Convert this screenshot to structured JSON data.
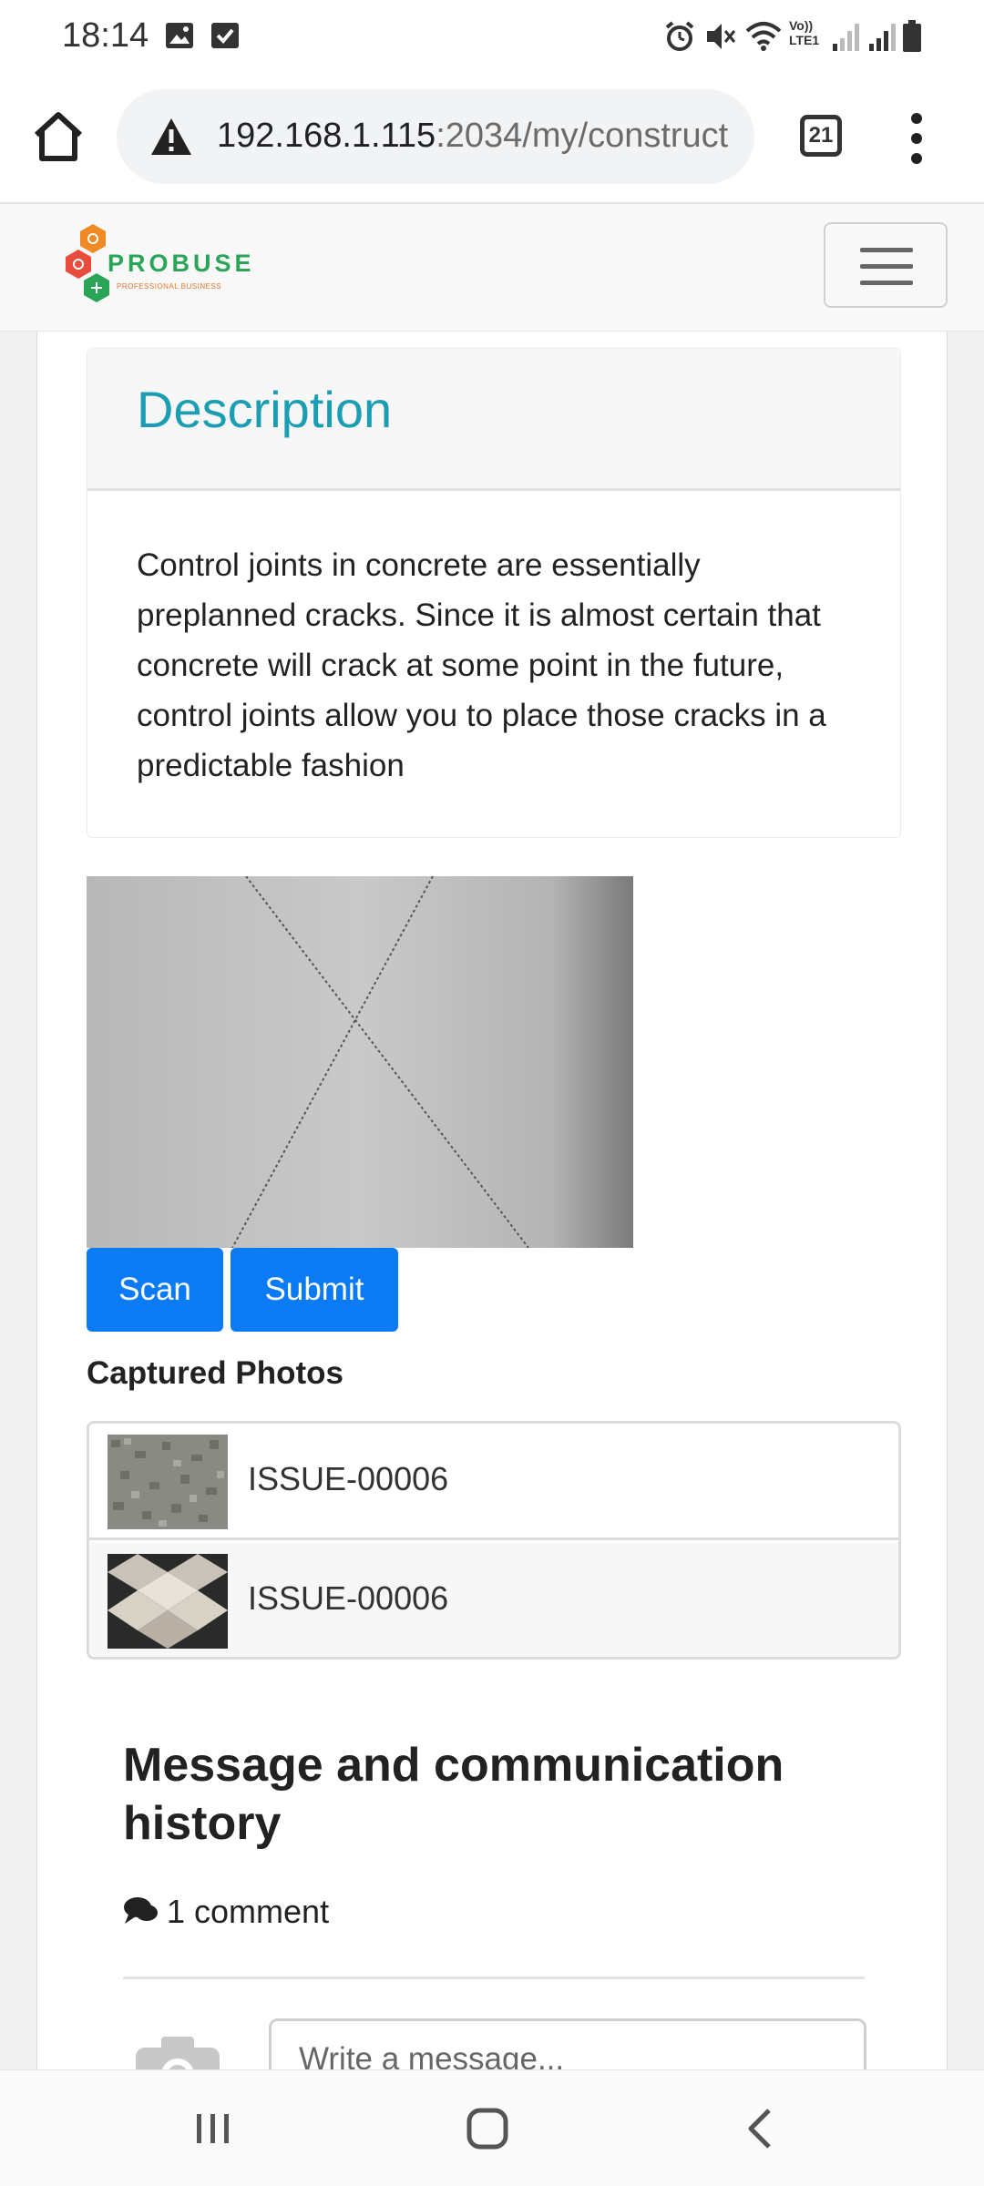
{
  "status_bar": {
    "time": "18:14",
    "left_icons": [
      "image-icon",
      "checkbox-icon"
    ],
    "right_icons": [
      "alarm-icon",
      "mute-icon",
      "wifi-icon",
      "volte-icon",
      "signal-icon",
      "signal-icon",
      "battery-icon"
    ],
    "volte_label": "Vo)) LTE1"
  },
  "browser": {
    "url_host": "192.168.1.115",
    "url_path": ":2034/my/construct",
    "tab_count": "21",
    "icons": {
      "home": "home-icon",
      "warning": "warning-icon",
      "menu": "more-vert-icon"
    }
  },
  "navbar": {
    "logo_text": "PROBUSE",
    "logo_tagline": "PROFESSIONAL BUSINESS",
    "toggler_icon": "hamburger-icon"
  },
  "description": {
    "title": "Description",
    "body": "Control joints in concrete are essentially preplanned cracks. Since it is almost certain that concrete will crack at some point in the future, control joints allow you to place those cracks in a predictable fashion"
  },
  "buttons": {
    "scan": "Scan",
    "submit": "Submit"
  },
  "captured": {
    "title": "Captured Photos",
    "items": [
      {
        "label": "ISSUE-00006"
      },
      {
        "label": "ISSUE-00006"
      }
    ]
  },
  "messages": {
    "title": "Message and communication history",
    "comment_count": "1 comment",
    "input_placeholder": "Write a message..."
  },
  "nav_bar": {
    "icons": [
      "recents-icon",
      "home-icon",
      "back-icon"
    ]
  },
  "colors": {
    "accent": "#0a7af5",
    "title_teal": "#1b9eb3",
    "logo_green": "#2aa558",
    "logo_orange": "#f08a24"
  }
}
